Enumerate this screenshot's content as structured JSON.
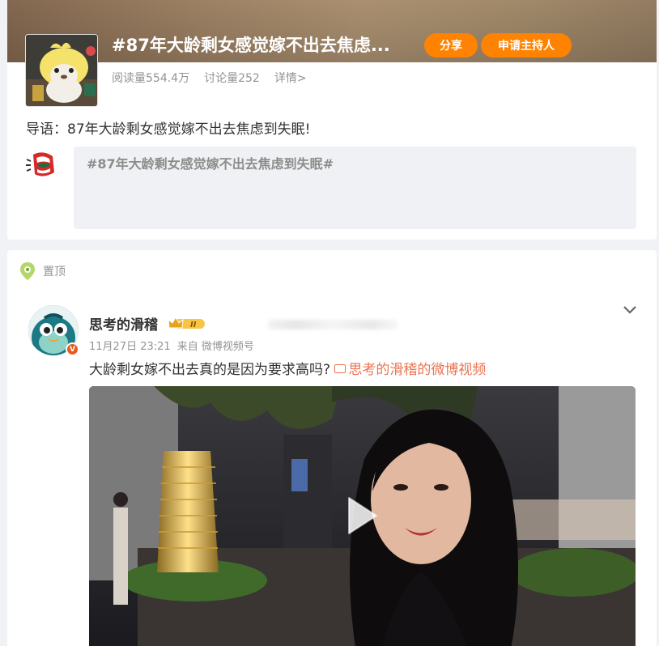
{
  "topic": {
    "title": "#87年大龄剩女感觉嫁不出去焦虑...",
    "share_label": "分享",
    "host_label": "申请主持人",
    "read_count": "阅读量554.4万",
    "discuss_count": "讨论量252",
    "detail_link": "详情>",
    "guide": "导语：87年大龄剩女感觉嫁不出去焦虑到失眠!",
    "compose_placeholder": "#87年大龄剩女感觉嫁不出去焦虑到失眠#"
  },
  "pinned": {
    "label": "置顶"
  },
  "post": {
    "author": "思考的滑稽",
    "badge_text": "II",
    "verified_mark": "V",
    "time": "11月27日 23:21",
    "source": "来自 微博视频号",
    "text": "大龄剩女嫁不出去真的是因为要求高吗?",
    "video_link": "思考的滑稽的微博视频"
  },
  "colors": {
    "accent": "#ff8200",
    "link": "#eb7350",
    "muted": "#939393"
  },
  "icons": {
    "compose": "megaphone-mouth-icon",
    "pin": "location-pin-icon",
    "expand": "chevron-down-icon",
    "play": "play-icon"
  }
}
